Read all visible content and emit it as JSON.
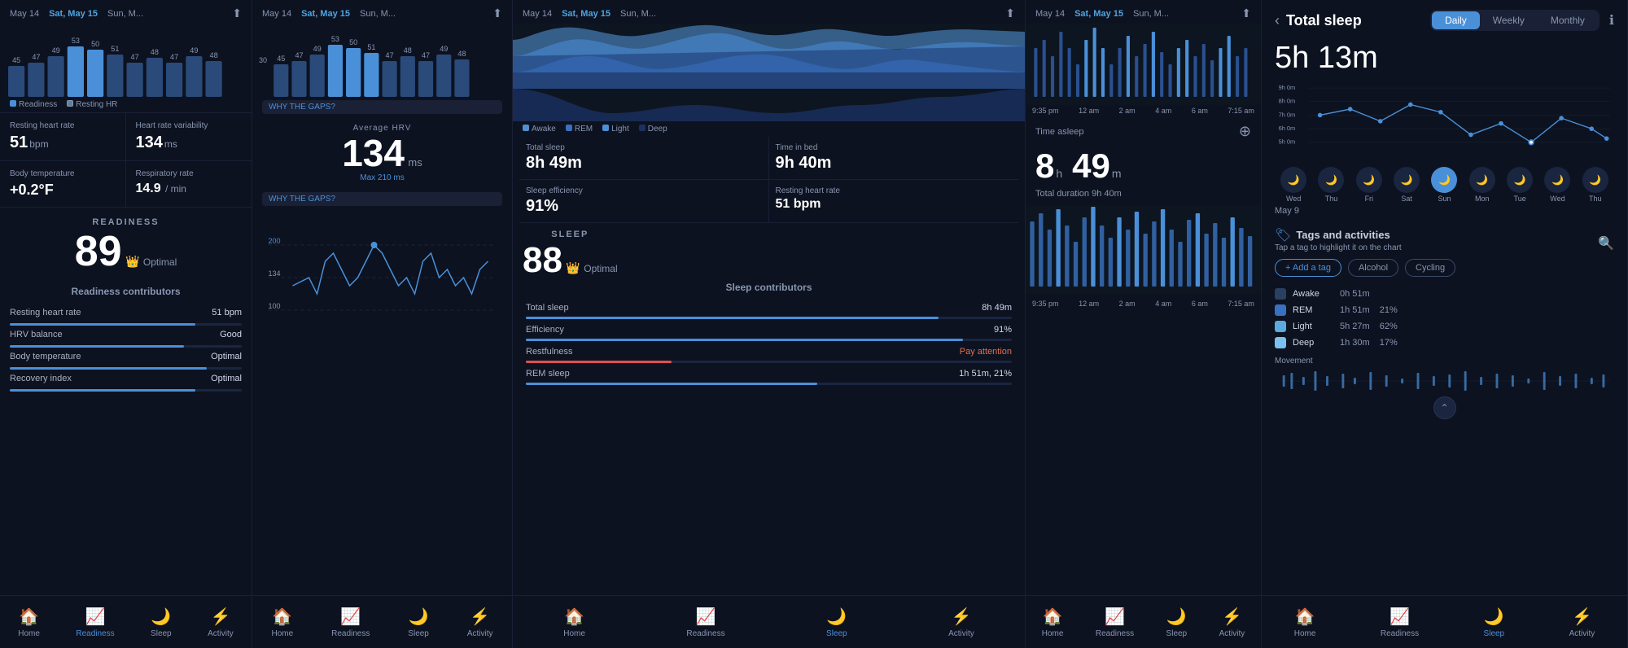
{
  "panels": [
    {
      "id": "readiness",
      "dates": [
        "May 14",
        "Sat, May 15",
        "Sun, M..."
      ],
      "activeDateIndex": 1,
      "bars": [
        45,
        47,
        49,
        53,
        50,
        51,
        47,
        48,
        47,
        49,
        48
      ],
      "stats": [
        {
          "label": "Resting heart rate",
          "value": "51",
          "unit": "bpm"
        },
        {
          "label": "Heart rate variability",
          "value": "134",
          "unit": "ms"
        },
        {
          "label": "Body temperature",
          "value": "+0.2°F",
          "unit": ""
        },
        {
          "label": "Respiratory rate",
          "value": "14.9 / min",
          "unit": ""
        }
      ],
      "score": {
        "title": "READINESS",
        "value": "89",
        "badge": "Optimal"
      },
      "contributors": [
        {
          "label": "Resting heart rate",
          "value": "51 bpm",
          "pct": 80,
          "status": "good"
        },
        {
          "label": "HRV balance",
          "value": "Good",
          "pct": 75,
          "status": "good"
        },
        {
          "label": "Body temperature",
          "value": "Optimal",
          "pct": 85,
          "status": "optimal"
        },
        {
          "label": "Recovery index",
          "value": "Optimal",
          "pct": 80,
          "status": "optimal"
        }
      ],
      "nav": [
        {
          "icon": "🏠",
          "label": "Home",
          "active": false
        },
        {
          "icon": "📈",
          "label": "Readiness",
          "active": true
        },
        {
          "icon": "🌙",
          "label": "Sleep",
          "active": false
        },
        {
          "icon": "⚡",
          "label": "Activity",
          "active": false
        }
      ]
    },
    {
      "id": "hrv",
      "dates": [
        "May 14",
        "Sat, May 15",
        "Sun, M..."
      ],
      "activeDateIndex": 1,
      "avgHRV": {
        "label": "Average HRV",
        "value": "134",
        "unit": "ms",
        "max": "Max 210 ms"
      },
      "nav": [
        {
          "icon": "🏠",
          "label": "Home",
          "active": false
        },
        {
          "icon": "📈",
          "label": "Readiness",
          "active": false
        },
        {
          "icon": "🌙",
          "label": "Sleep",
          "active": false
        },
        {
          "icon": "⚡",
          "label": "Activity",
          "active": false
        }
      ]
    },
    {
      "id": "sleep",
      "dates": [
        "May 14",
        "Sat, May 15",
        "Sun, M..."
      ],
      "activeDateIndex": 1,
      "legend": [
        {
          "label": "Awake",
          "color": "#2a5080"
        },
        {
          "label": "REM",
          "color": "#3a70b0"
        },
        {
          "label": "Light",
          "color": "#4a90d9"
        },
        {
          "label": "Deep",
          "color": "#6abae0"
        }
      ],
      "stats": [
        {
          "label": "Total sleep",
          "value": "8h 49m",
          "unit": ""
        },
        {
          "label": "Time in bed",
          "value": "9h 40m",
          "unit": ""
        },
        {
          "label": "Sleep efficiency",
          "value": "91%",
          "unit": ""
        },
        {
          "label": "Resting heart rate",
          "value": "51 bpm",
          "unit": ""
        }
      ],
      "score": {
        "title": "SLEEP",
        "value": "88",
        "badge": "Optimal"
      },
      "contributors": [
        {
          "label": "Total sleep",
          "value": "8h 49m",
          "pct": 85,
          "status": "good"
        },
        {
          "label": "Efficiency",
          "value": "91%",
          "pct": 90,
          "status": "good"
        },
        {
          "label": "Restfulness",
          "value": "Pay attention",
          "pct": 30,
          "status": "attention"
        },
        {
          "label": "REM sleep",
          "value": "1h 51m, 21%",
          "pct": 60,
          "status": "good"
        }
      ],
      "nav": [
        {
          "icon": "🏠",
          "label": "Home",
          "active": false
        },
        {
          "icon": "📈",
          "label": "Readiness",
          "active": false
        },
        {
          "icon": "🌙",
          "label": "Sleep",
          "active": true
        },
        {
          "icon": "⚡",
          "label": "Activity",
          "active": false
        }
      ]
    },
    {
      "id": "time-asleep",
      "dates": [
        "May 14",
        "Sat, May 15",
        "Sun, M..."
      ],
      "activeDateIndex": 1,
      "timeAsleep": {
        "h": "8",
        "m": "49",
        "unit_h": "h",
        "unit_m": "m"
      },
      "totalDuration": "Total duration 9h 40m",
      "timeLabels": [
        "9:35 pm",
        "12 am",
        "2 am",
        "4 am",
        "6 am",
        "7:15 am"
      ],
      "nav": [
        {
          "icon": "🏠",
          "label": "Home",
          "active": false
        },
        {
          "icon": "📈",
          "label": "Readiness",
          "active": false
        },
        {
          "icon": "🌙",
          "label": "Sleep",
          "active": false
        },
        {
          "icon": "⚡",
          "label": "Activity",
          "active": false
        }
      ]
    },
    {
      "id": "total-sleep-detail",
      "title": "Total sleep",
      "periods": [
        "Daily",
        "Weekly",
        "Monthly"
      ],
      "activePeriod": "Daily",
      "totalTime": "5h 13m",
      "chartYLabels": [
        "9h 0m",
        "8h 0m",
        "7h 0m",
        "6h 0m",
        "5h 0m"
      ],
      "dayIcons": [
        {
          "icon": "🌙",
          "label": "Wed",
          "sublabel": "",
          "active": false
        },
        {
          "icon": "🌙",
          "label": "Thu",
          "sublabel": "",
          "active": false
        },
        {
          "icon": "🌙",
          "label": "Fri",
          "sublabel": "",
          "active": false
        },
        {
          "icon": "🌙",
          "label": "Sat",
          "sublabel": "",
          "active": false
        },
        {
          "icon": "🌙",
          "label": "Sun",
          "sublabel": "",
          "active": true
        },
        {
          "icon": "🌙",
          "label": "Mon",
          "sublabel": "",
          "active": false
        },
        {
          "icon": "🌙",
          "label": "Tue",
          "sublabel": "",
          "active": false
        },
        {
          "icon": "🌙",
          "label": "Wed",
          "sublabel": "",
          "active": false
        },
        {
          "icon": "🌙",
          "label": "Thu",
          "sublabel": "",
          "active": false
        }
      ],
      "selectedDate": "May 9",
      "tags": {
        "title": "Tags and activities",
        "subtitle": "Tap a tag to highlight it on the chart",
        "buttons": [
          "+ Add a tag",
          "Alcohol",
          "Cycling"
        ]
      },
      "sleepStages": [
        {
          "name": "Awake",
          "color": "#2a4060",
          "time": "0h 51m",
          "pct": ""
        },
        {
          "name": "REM",
          "color": "#3a70c0",
          "time": "1h 51m",
          "pct": "21%"
        },
        {
          "name": "Light",
          "color": "#5aaae0",
          "time": "5h 27m",
          "pct": "62%"
        },
        {
          "name": "Deep",
          "color": "#7ac0f0",
          "time": "1h 30m",
          "pct": "17%"
        }
      ],
      "movementLabel": "Movement",
      "nav": [
        {
          "icon": "🏠",
          "label": "Home",
          "active": false
        },
        {
          "icon": "📈",
          "label": "Readiness",
          "active": false
        },
        {
          "icon": "🌙",
          "label": "Sleep",
          "active": true
        },
        {
          "icon": "⚡",
          "label": "Activity",
          "active": false
        }
      ]
    }
  ]
}
